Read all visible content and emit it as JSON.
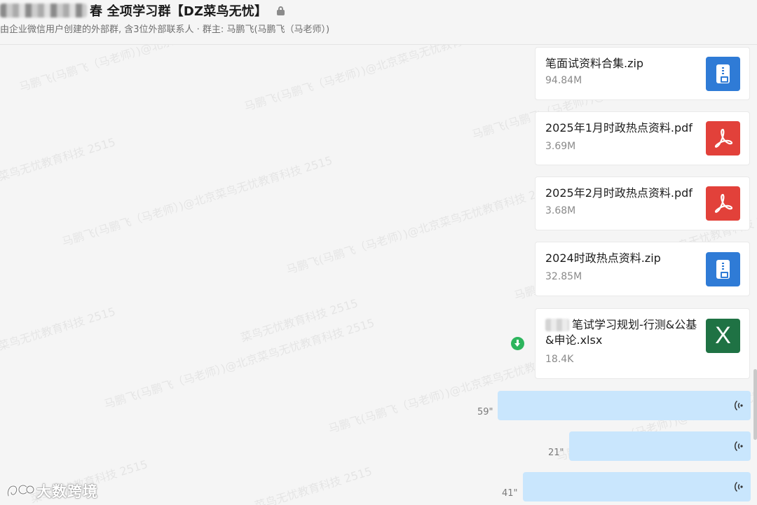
{
  "header": {
    "title": "春 全项学习群【DZ菜鸟无忧】",
    "subtitle": "由企业微信用户创建的外部群, 含3位外部联系人 · 群主: 马鹏飞(马鹏飞（马老师）)"
  },
  "watermark": {
    "text_a": "马鹏飞(马鹏飞（马老师）)@北京菜鸟无忧教育科技 2515",
    "text_b": "菜鸟无忧教育科技 2515"
  },
  "messages": {
    "files": [
      {
        "name": "笔面试资料合集.zip",
        "size": "94.84M",
        "icon": "zip-icon"
      },
      {
        "name": "2025年1月时政热点资料.pdf",
        "size": "3.69M",
        "icon": "pdf-icon"
      },
      {
        "name": "2025年2月时政热点资料.pdf",
        "size": "3.68M",
        "icon": "pdf-icon"
      },
      {
        "name": "2024时政热点资料.zip",
        "size": "32.85M",
        "icon": "zip-icon"
      },
      {
        "name": "笔试学习规划-行测&公基&申论.xlsx",
        "size": "18.4K",
        "icon": "excel-icon",
        "icon_letter": "X"
      }
    ],
    "voices": [
      {
        "duration": "59\""
      },
      {
        "duration": "21\""
      },
      {
        "duration": "41\""
      }
    ]
  },
  "brand": {
    "text": "大数跨境"
  },
  "colors": {
    "zip": "#2f7bd6",
    "pdf": "#e2413a",
    "excel": "#1f7244",
    "voice_bubble": "#c9e6fd",
    "download": "#2db55d"
  }
}
